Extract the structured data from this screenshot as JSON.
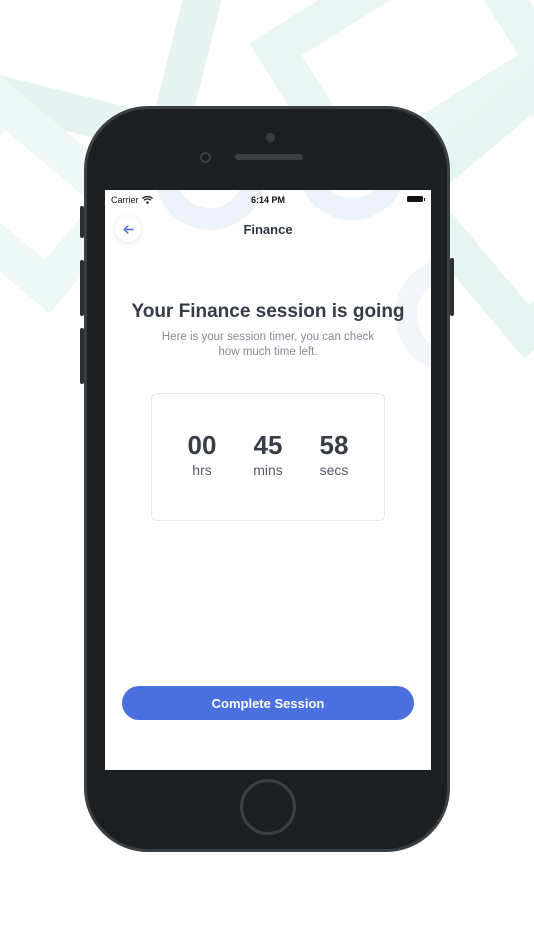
{
  "status_bar": {
    "carrier": "Carrier",
    "time": "6:14 PM"
  },
  "nav": {
    "title": "Finance",
    "back_icon": "arrow-left-icon"
  },
  "session": {
    "heading": "Your Finance session is going",
    "subtitle": "Here is your session timer, you can check how much time left."
  },
  "timer": {
    "hours": "00",
    "hours_label": "hrs",
    "minutes": "45",
    "minutes_label": "mins",
    "seconds": "58",
    "seconds_label": "secs"
  },
  "actions": {
    "complete_label": "Complete Session"
  },
  "colors": {
    "accent": "#4a6fde",
    "heading": "#353b47",
    "muted": "#858b95",
    "background_shape": "#e6f4f1"
  }
}
